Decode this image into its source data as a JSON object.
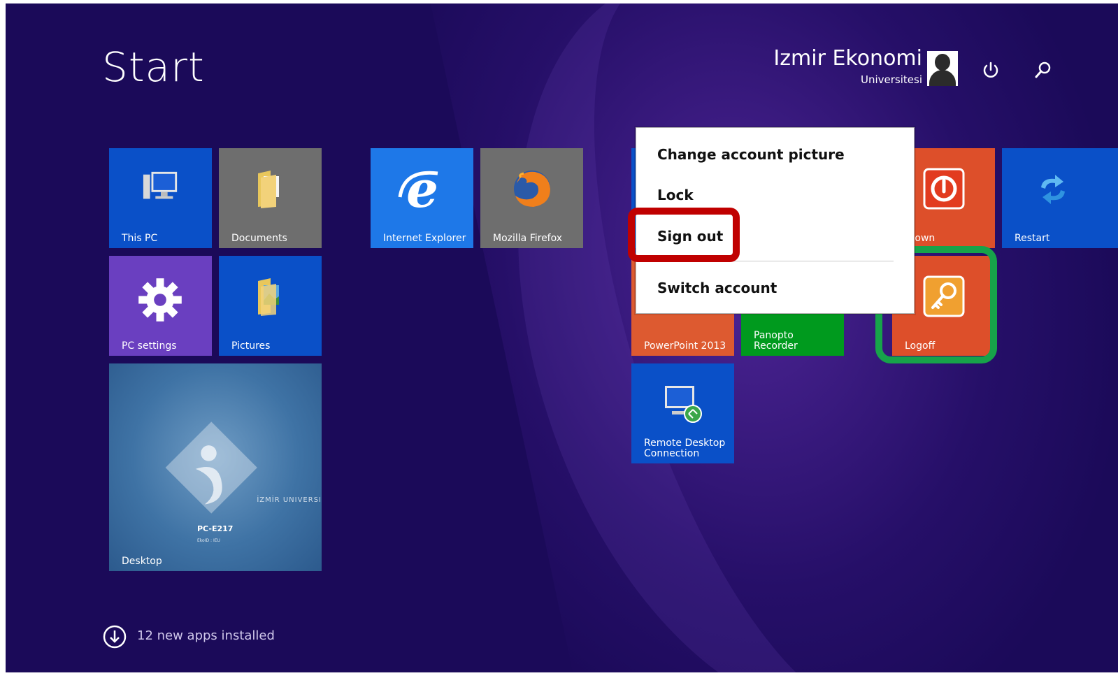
{
  "start": {
    "title": "Start"
  },
  "user": {
    "name": "Izmir Ekonomi",
    "org": "Universitesi"
  },
  "tiles": {
    "this_pc": "This PC",
    "documents": "Documents",
    "internet_explorer": "Internet Explorer",
    "firefox": "Mozilla Firefox",
    "pc_settings": "PC settings",
    "pictures": "Pictures",
    "desktop": "Desktop",
    "desktop_pc_name": "PC-E217",
    "desktop_pc_sub": "EkoID : IEU",
    "desktop_university": "İZMİR UNIVERSI",
    "powerpoint": "PowerPoint 2013",
    "panopto": "Panopto Recorder",
    "remote_desktop": "Remote Desktop Connection",
    "shutdown": "tdown",
    "restart": "Restart",
    "logoff": "Logoff"
  },
  "account_menu": {
    "items": [
      "Change account picture",
      "Lock",
      "Sign out",
      "Switch account"
    ]
  },
  "footer": {
    "apps_installed": "12 new apps installed"
  },
  "colors": {
    "background": "#1b0a59",
    "tile_blue": "#0a50c8",
    "tile_gray": "#6e6e6e",
    "tile_purple": "#6a3fc0",
    "tile_orange": "#dd4f2a",
    "tile_green": "#009a1e",
    "highlight_red": "#c00000",
    "highlight_green": "#17a34a"
  }
}
